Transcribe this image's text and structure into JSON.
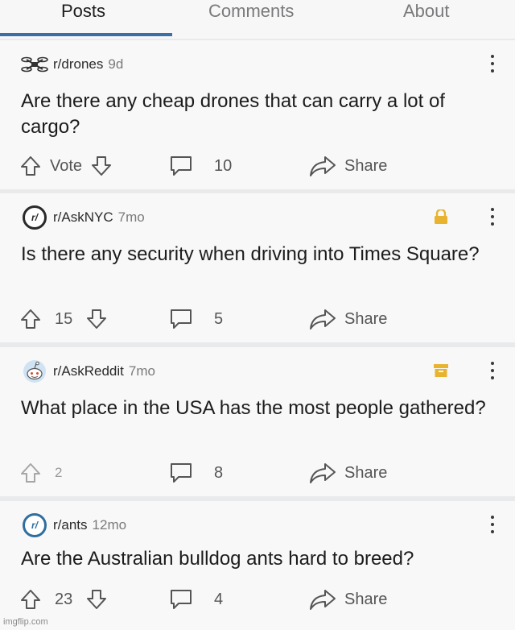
{
  "tabs": [
    "Posts",
    "Comments",
    "About"
  ],
  "posts": [
    {
      "subreddit": "r/drones",
      "age": "9d",
      "title": "Are there any cheap drones that can carry a lot of cargo?",
      "votes": "Vote",
      "comments": "10",
      "share": "Share",
      "avatar_icon": "drone-icon"
    },
    {
      "subreddit": "r/AskNYC",
      "age": "7mo",
      "title": "Is there any security when driving into Times Square?",
      "votes": "15",
      "comments": "5",
      "share": "Share",
      "badge_icon": "lock-icon",
      "badge_color": "#e8b32e",
      "avatar_label": "r/"
    },
    {
      "subreddit": "r/AskReddit",
      "age": "7mo",
      "title": "What place in the USA has the most people gathered?",
      "votes": "2",
      "comments": "8",
      "share": "Share",
      "badge_icon": "archive-icon",
      "badge_color": "#e8b32e",
      "avatar_icon": "snoo-icon"
    },
    {
      "subreddit": "r/ants",
      "age": "12mo",
      "title": "Are the Australian bulldog ants hard to breed?",
      "votes": "23",
      "comments": "4",
      "share": "Share",
      "avatar_label": "r/"
    }
  ],
  "watermark": "imgflip.com",
  "colors": {
    "accent": "#3c6fa6",
    "badge": "#e8b32e",
    "background": "#f8f8f9"
  }
}
